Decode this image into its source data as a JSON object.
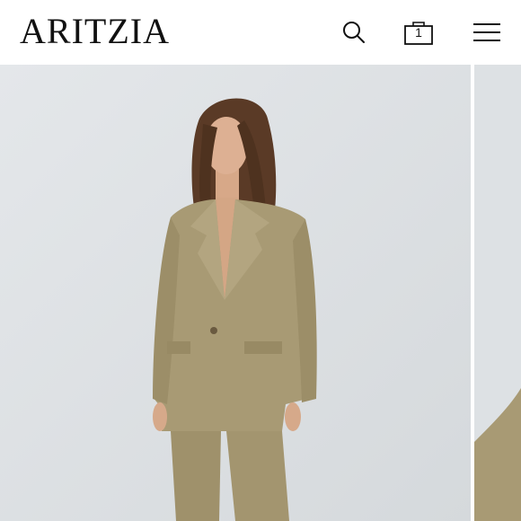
{
  "header": {
    "logo_text": "ARITZIA",
    "search_icon": "search-icon",
    "bag_icon": "shopping-bag-icon",
    "bag_count": "1",
    "menu_icon": "hamburger-menu-icon"
  },
  "colors": {
    "blazer": "#a89a74",
    "background": "#dfe3e6"
  }
}
